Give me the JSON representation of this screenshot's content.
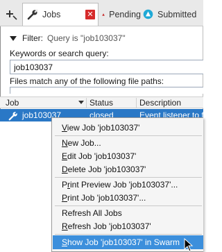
{
  "tabs": [
    {
      "id": "jobs",
      "label": "Jobs",
      "icon": "wrench-icon",
      "active": true
    },
    {
      "id": "pending",
      "label": "Pending",
      "icon": "red-triangle-icon",
      "active": false
    },
    {
      "id": "submitted",
      "label": "Submitted",
      "icon": "submitted-icon",
      "active": false
    }
  ],
  "filter": {
    "label": "Filter:",
    "query_text": "Query is \"job103037\""
  },
  "keywords": {
    "label": "Keywords or search query:",
    "value": "job103037"
  },
  "files": {
    "label": "Files match any of the following file paths:"
  },
  "grid": {
    "columns": [
      "Job",
      "Status",
      "Description"
    ],
    "row": {
      "job": "job103037",
      "status": "closed",
      "description": "Event listener to fi"
    }
  },
  "context_menu": {
    "items": [
      {
        "pre": "",
        "u": "V",
        "post": "iew Job 'job103037'"
      },
      {
        "pre": "",
        "u": "N",
        "post": "ew Job..."
      },
      {
        "pre": "",
        "u": "E",
        "post": "dit Job 'job103037'"
      },
      {
        "pre": "",
        "u": "D",
        "post": "elete Job 'job103037'"
      },
      {
        "pre": "P",
        "u": "r",
        "post": "int Preview Job 'job103037'..."
      },
      {
        "pre": "",
        "u": "P",
        "post": "rint Job 'job103037'..."
      },
      {
        "pre": "Refresh All Jobs",
        "u": "",
        "post": ""
      },
      {
        "pre": "",
        "u": "R",
        "post": "efresh Job 'job103037'"
      },
      {
        "pre": "",
        "u": "S",
        "post": "how Job 'job103037' in Swarm"
      }
    ]
  },
  "colors": {
    "selection": "#2a78c6",
    "menu_highlight": "#3c8fdc",
    "close_red": "#d62b2b",
    "submitted_cyan": "#1fa9d6"
  }
}
